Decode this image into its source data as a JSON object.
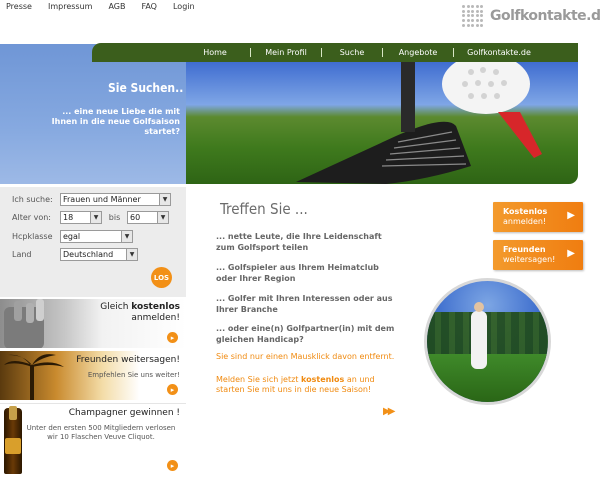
{
  "topnav": {
    "items": [
      "Presse",
      "Impressum",
      "AGB",
      "FAQ",
      "Login"
    ]
  },
  "logo": {
    "text": "Golfkontakte.de"
  },
  "mainnav": {
    "items": [
      "Home",
      "Mein Profil",
      "Suche",
      "Angebote",
      "Golfkontakte.de"
    ]
  },
  "hero": {
    "title": "Sie Suchen..",
    "subtitle": "... eine neue Liebe die mit Ihnen in die neue Golfsaison startet?"
  },
  "search": {
    "rows": [
      {
        "label": "Ich suche:",
        "value": "Frauen und Männer"
      },
      {
        "label": "Alter von:",
        "value_from": "18",
        "between": "bis",
        "value_to": "60"
      },
      {
        "label": "Hcpklasse",
        "value": "egal"
      },
      {
        "label": "Land",
        "value": "Deutschland"
      }
    ],
    "submit_label": "LOS"
  },
  "promos": {
    "p1": {
      "line1_prefix": "Gleich ",
      "line1_bold": "kostenlos",
      "line2": "anmelden!"
    },
    "p2": {
      "title": "Freunden weitersagen!",
      "sub": "Empfehlen Sie uns weiter!"
    },
    "p3": {
      "title": "Champagner gewinnen !",
      "desc": "Unter den ersten 500 Mitgliedern verlosen wir 10 Flaschen Veuve Cliquot."
    }
  },
  "center": {
    "title": "Treffen Sie ...",
    "features": [
      "... nette Leute, die Ihre Leidenschaft zum Golfsport teilen",
      "... Golfspieler aus Ihrem Heimatclub oder Ihrer Region",
      "... Golfer mit Ihren Interessen oder aus Ihrer Branche",
      "... oder eine(n) Golfpartner(in) mit dem gleichen Handicap?"
    ],
    "cta1": "Sie sind nur einen Mausklick davon entfernt.",
    "cta2_prefix": "Melden Sie sich jetzt ",
    "cta2_bold": "kostenlos",
    "cta2_suffix": " an und starten Sie mit uns in die neue Saison!",
    "forward_icon": "double-chevron"
  },
  "right": {
    "btn1": {
      "line1": "Kostenlos",
      "line2": "anmelden!"
    },
    "btn2": {
      "line1": "Freunden",
      "line2": "weitersagen!"
    }
  },
  "colors": {
    "nav_green": "#3b5e1c",
    "accent_orange": "#f29017"
  }
}
